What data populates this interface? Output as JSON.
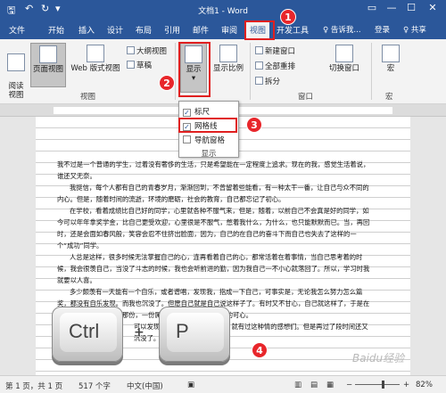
{
  "window": {
    "title": "文档1 - Word"
  },
  "quick_access": {
    "save_icon": "save-icon",
    "undo_icon": "undo-icon",
    "redo_icon": "redo-icon",
    "customize_icon": "customize-icon"
  },
  "window_controls": {
    "ribbon_options": "▭",
    "minimize": "—",
    "maximize": "☐",
    "close": "✕"
  },
  "tabs": [
    "文件",
    "开始",
    "插入",
    "设计",
    "布局",
    "引用",
    "邮件",
    "审阅",
    "视图",
    "开发工具"
  ],
  "active_tab": "视图",
  "tab_right": {
    "tell_me": "♀ 告诉我...",
    "login": "登录",
    "share": "♀ 共享"
  },
  "ribbon": {
    "views": {
      "read_mode": "阅读\n视图",
      "print_layout": "页面视图",
      "web_layout": "Web 版式视图",
      "outline": "大纲视图",
      "draft": "草稿",
      "group_label": "视图"
    },
    "show": {
      "label": "显示",
      "arrow": "▾"
    },
    "zoom": {
      "label": "显示比例"
    },
    "window": {
      "new_window": "新建窗口",
      "arrange_all": "全部重排",
      "split": "拆分",
      "switch_windows": "切换窗口",
      "group_label": "窗口"
    },
    "macros": {
      "label": "宏",
      "group_label": "宏"
    }
  },
  "show_dropdown": {
    "items": [
      {
        "label": "标尺",
        "checked": true
      },
      {
        "label": "网格线",
        "checked": true
      },
      {
        "label": "导航窗格",
        "checked": false
      }
    ],
    "group_label": "显示"
  },
  "annotations": {
    "step1": "1",
    "step2": "2",
    "step3": "3",
    "step4": "4"
  },
  "document": {
    "paragraphs": [
      "我不过是一个普通的学生，过着没有奢侈的生活，只是希望能在一定程度上追求。现在的我，感觉生活着说，谁还又无奈。",
      "我挺信，每个人都有自己的青春岁月，渐渐回到，不曾留着些能看，有一种太干一番，让自己与众不同的内心。但是，随着时间的流逝，环境的磨砺，社会的教育，自己都忘记了初心。",
      "在学校，看着成绩比自己好的同学，心里就各种不服气来，但是，随着，以前自己不会真是好的同学，如今可以年年拿奖学金，比自己更受欢迎，心里很是不服气，憋着我什么，为什么，也只能默默而已。当，再回时，还是会面如春风般，笑容会忍不住挤出脸面，因为，自己的在自己的奋斗下而自己也失去了这样的一个“成功”同学。",
      "人总是这样，很多时候无法掌握自己的心，连再看着自己的心，都常活着在着事情，当自己思考着的时候，我会很羡自己，当没了斗志的时候，我也会听前进的勤，因为我自己一不小心就落回了。所以，学习时我就要以人喜。",
      "多少颇羡有一天能有一个自乐，或者谱唱，发现我，指成一下自己，可事实是，无论我怎么努力怎么篇奖，都没有自乐发现。而我也沉没了。但愿自己就是自己说这样子了。有时又不甘心，自己就这样了，于是在怎么也找到属于自己的那份，一份属于，也得作为这个位置的可心。",
      "可以发现只为了比自己奢侈的人，就有过这种情的感想们。但是再过了段时间还又沉没了。"
    ]
  },
  "keys": {
    "ctrl": "Ctrl",
    "plus": "+",
    "p": "P"
  },
  "status_bar": {
    "page": "第 1 页，共 1 页",
    "words": "517 个字",
    "language": "中文(中国)",
    "zoom_out": "−",
    "zoom_in": "+",
    "zoom": "82%"
  },
  "watermark": "Baidu经验"
}
